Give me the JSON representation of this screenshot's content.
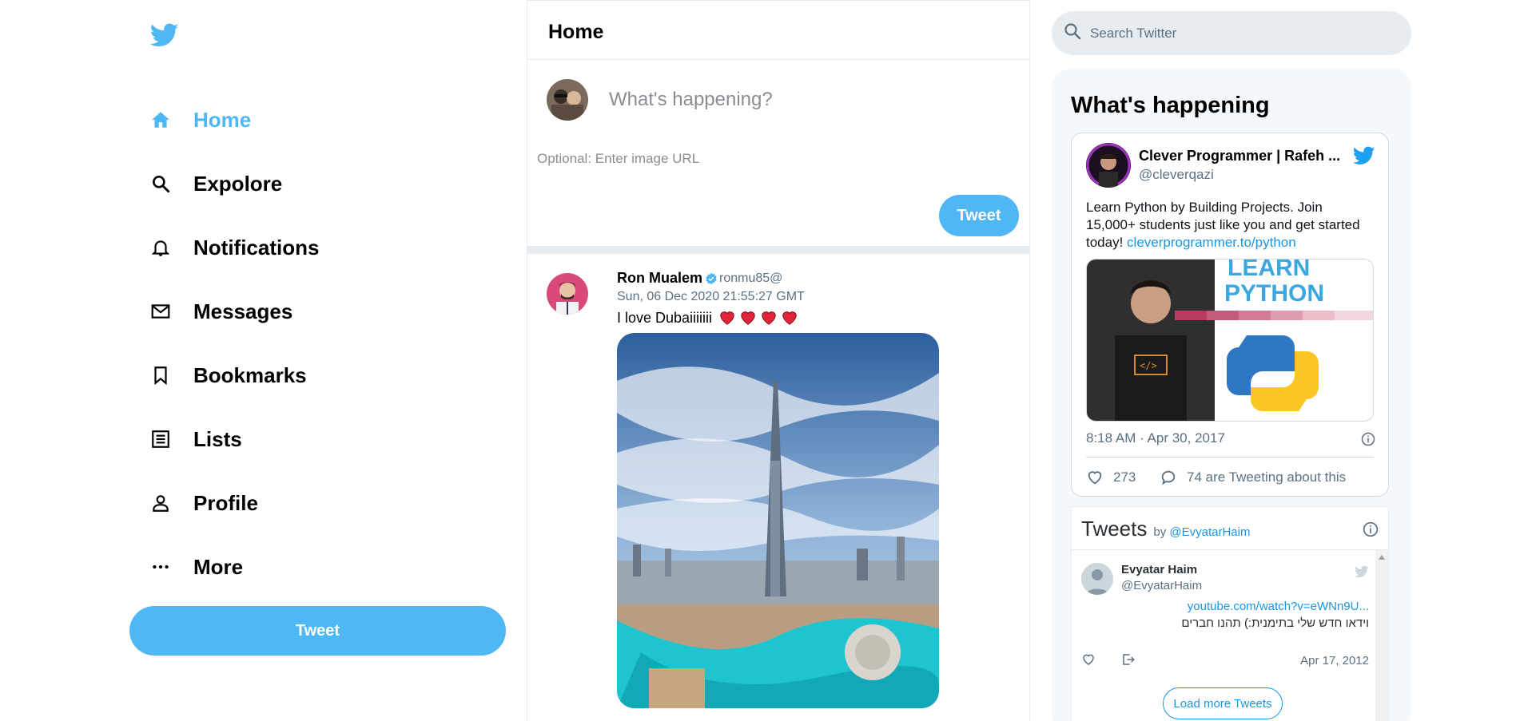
{
  "sidebar": {
    "logo_icon": "twitter-bird-icon",
    "items": [
      {
        "label": "Home",
        "icon": "home-icon",
        "active": true
      },
      {
        "label": "Expolore",
        "icon": "search-icon",
        "active": false
      },
      {
        "label": "Notifications",
        "icon": "bell-icon",
        "active": false
      },
      {
        "label": "Messages",
        "icon": "mail-icon",
        "active": false
      },
      {
        "label": "Bookmarks",
        "icon": "bookmark-icon",
        "active": false
      },
      {
        "label": "Lists",
        "icon": "list-icon",
        "active": false
      },
      {
        "label": "Profile",
        "icon": "person-icon",
        "active": false
      },
      {
        "label": "More",
        "icon": "more-dots-icon",
        "active": false
      }
    ],
    "tweet_button": "Tweet"
  },
  "feed": {
    "title": "Home",
    "tweetbox": {
      "placeholder": "What's happening?",
      "image_placeholder": "Optional: Enter image URL",
      "button": "Tweet"
    },
    "post": {
      "name": "Ron Mualem",
      "handle": "ronmu85@",
      "date": "Sun, 06 Dec 2020 21:55:27 GMT",
      "text": "I love Dubaiiiiiii"
    }
  },
  "widgets": {
    "search_placeholder": "Search Twitter",
    "title": "What's happening",
    "embed": {
      "name": "Clever Programmer | Rafeh ...",
      "handle": "@cleverqazi",
      "text": "Learn Python by Building Projects. Join 15,000+ students just like you and get started today! ",
      "link": "cleverprogrammer.to/python",
      "media_text_1": "LEARN",
      "media_text_2": "PYTHON",
      "time": "8:18 AM · Apr 30, 2017",
      "likes": "273",
      "replies": "74 are Tweeting about this"
    },
    "timeline": {
      "title": "Tweets",
      "by_label": "by",
      "by_handle": "@EvyatarHaim",
      "name": "Evyatar Haim",
      "handle": "@EvyatarHaim",
      "link": "youtube.com/watch?v=eWNn9U...",
      "text": "וידאו חדש שלי בתימנית:) תהנו חברים",
      "date": "Apr 17, 2012",
      "load_more": "Load more Tweets"
    }
  },
  "colors": {
    "accent": "#50b7f5",
    "link": "#1b95e0",
    "border": "#e6ecf0"
  }
}
